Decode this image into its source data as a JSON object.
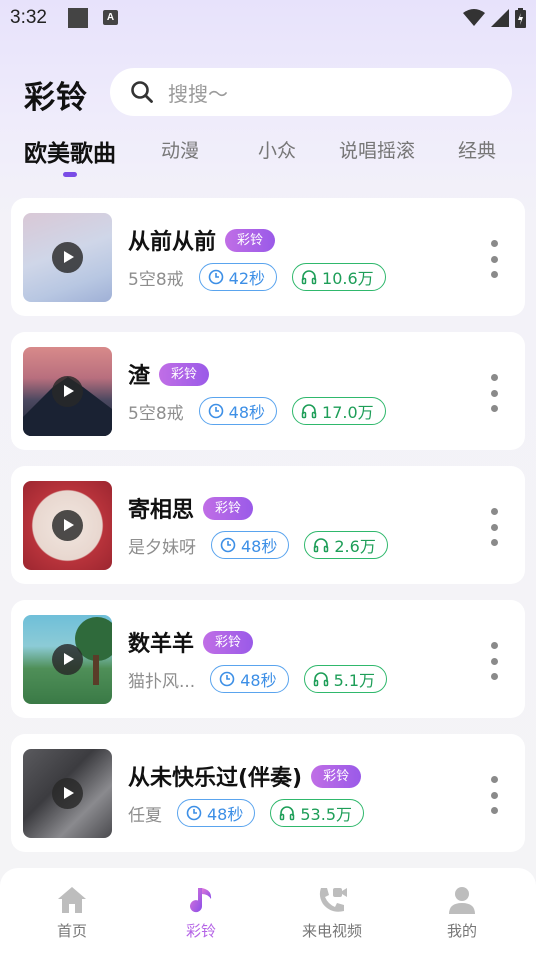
{
  "status_bar": {
    "time": "3:32",
    "a_glyph": "A"
  },
  "header": {
    "title": "彩铃",
    "search_placeholder": "搜搜～"
  },
  "tabs": [
    {
      "label": "欧美歌曲",
      "active": true
    },
    {
      "label": "动漫"
    },
    {
      "label": "小众"
    },
    {
      "label": "说唱摇滚"
    },
    {
      "label": "经典"
    }
  ],
  "songs": [
    {
      "title": "从前从前",
      "tag": "彩铃",
      "artist": "5空8戒",
      "duration": "42秒",
      "plays": "10.6万"
    },
    {
      "title": "渣",
      "tag": "彩铃",
      "artist": "5空8戒",
      "duration": "48秒",
      "plays": "17.0万"
    },
    {
      "title": "寄相思",
      "tag": "彩铃",
      "artist": "是夕妹呀",
      "duration": "48秒",
      "plays": "2.6万"
    },
    {
      "title": "数羊羊",
      "tag": "彩铃",
      "artist": "猫扑风...",
      "duration": "48秒",
      "plays": "5.1万"
    },
    {
      "title": "从未快乐过(伴奏)",
      "tag": "彩铃",
      "artist": "任夏",
      "duration": "48秒",
      "plays": "53.5万"
    }
  ],
  "bottom_nav": [
    {
      "label": "首页",
      "icon": "home-icon"
    },
    {
      "label": "彩铃",
      "icon": "music-note-icon",
      "active": true
    },
    {
      "label": "来电视频",
      "icon": "phone-video-icon"
    },
    {
      "label": "我的",
      "icon": "user-icon"
    }
  ],
  "colors": {
    "accent": "#7a4ce6",
    "tag": "#b065e6",
    "duration": "#3d8fe6",
    "plays": "#1e9e58",
    "nav_active": "#b565e6"
  }
}
